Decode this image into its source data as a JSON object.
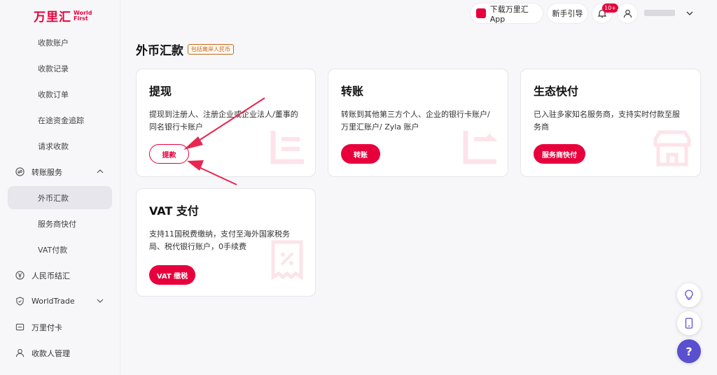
{
  "logo": {
    "cn": "万里汇",
    "en_line1": "World",
    "en_line2": "First"
  },
  "sidebar": {
    "items": [
      {
        "label": "收款账户"
      },
      {
        "label": "收款记录"
      },
      {
        "label": "收款订单"
      },
      {
        "label": "在途资金追踪"
      },
      {
        "label": "请求收款"
      },
      {
        "label": "转账服务"
      },
      {
        "label": "外币汇款"
      },
      {
        "label": "服务商快付"
      },
      {
        "label": "VAT付款"
      },
      {
        "label": "人民币结汇"
      },
      {
        "label": "WorldTrade"
      },
      {
        "label": "万里付卡"
      },
      {
        "label": "收款人管理"
      }
    ]
  },
  "header": {
    "download_app": "下载万里汇App",
    "guide": "新手引导",
    "notification_badge": "10+"
  },
  "page": {
    "title": "外币汇款",
    "tag": "包括离岸人民币"
  },
  "cards": [
    {
      "title": "提现",
      "desc_line1": "提现到注册人、注册企业或企业法人/董事的",
      "desc_line2": "同名银行卡账户",
      "button": "提款"
    },
    {
      "title": "转账",
      "desc_line1": "转账到其他第三方个人、企业的银行卡账户/",
      "desc_line2": "万里汇账户/ Zyla 账户",
      "button": "转账"
    },
    {
      "title": "生态快付",
      "desc_line1": "已入驻多家知名服务商，支持实时付款至服",
      "desc_line2": "务商",
      "button": "服务商快付"
    },
    {
      "title": "VAT 支付",
      "desc_line1": "支持11国税费缴纳，支付至海外国家税务",
      "desc_line2": "局、税代银行账户，0手续费",
      "button": "VAT 缴税"
    }
  ],
  "floating": {
    "help": "?"
  },
  "colors": {
    "brand": "#e8003d",
    "help": "#5a4fcf",
    "tag": "#c06a1e"
  }
}
